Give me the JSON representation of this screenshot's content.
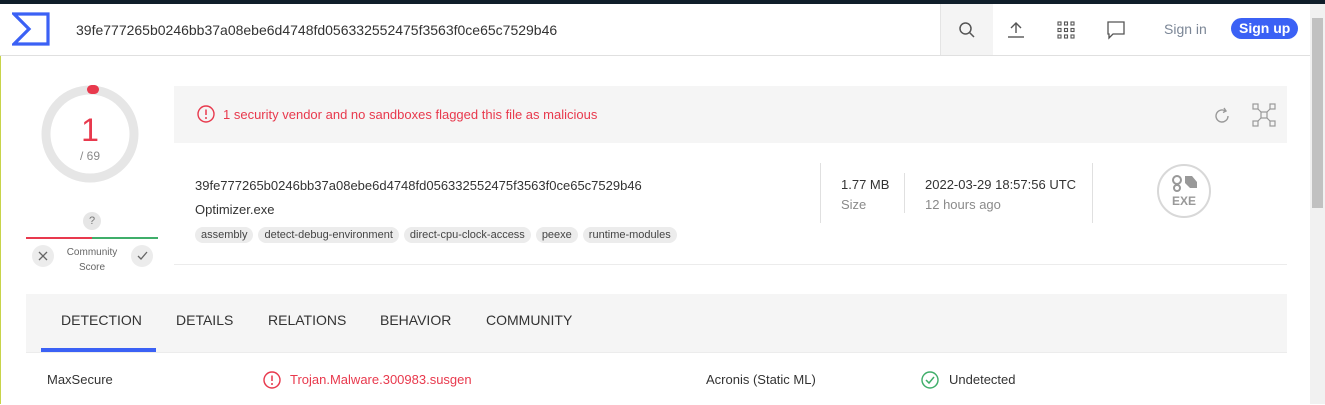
{
  "header": {
    "search_value": "39fe777265b0246bb37a08ebe6d4748fd056332552475f3563f0ce65c7529b46",
    "sign_in": "Sign in",
    "sign_up": "Sign up"
  },
  "score": {
    "detections": "1",
    "total": "/ 69",
    "community_help": "?",
    "community_label_1": "Community",
    "community_label_2": "Score"
  },
  "alert": {
    "message": "1 security vendor and no sandboxes flagged this file as malicious"
  },
  "file": {
    "hash": "39fe777265b0246bb37a08ebe6d4748fd056332552475f3563f0ce65c7529b46",
    "name": "Optimizer.exe",
    "tags": [
      "assembly",
      "detect-debug-environment",
      "direct-cpu-clock-access",
      "peexe",
      "runtime-modules"
    ],
    "size_value": "1.77 MB",
    "size_label": "Size",
    "date_value": "2022-03-29 18:57:56 UTC",
    "date_relative": "12 hours ago",
    "type_badge": "EXE"
  },
  "tabs": [
    "DETECTION",
    "DETAILS",
    "RELATIONS",
    "BEHAVIOR",
    "COMMUNITY"
  ],
  "detections": [
    {
      "vendor": "MaxSecure",
      "result": "Trojan.Malware.300983.susgen",
      "status": "malicious"
    },
    {
      "vendor": "Acronis (Static ML)",
      "result": "Undetected",
      "status": "clean"
    }
  ],
  "colors": {
    "accent": "#3b61f5",
    "malicious": "#e8394d",
    "clean": "#3fae6a"
  }
}
